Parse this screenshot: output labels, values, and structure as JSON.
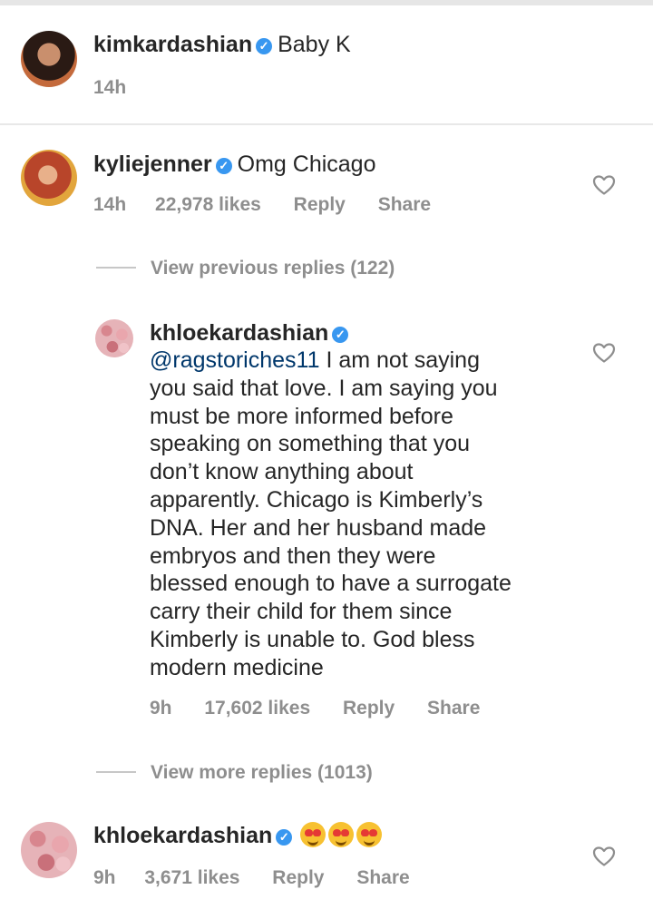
{
  "comments": [
    {
      "username": "kimkardashian",
      "text": "Baby K",
      "time": "14h"
    },
    {
      "username": "kyliejenner",
      "text": "Omg Chicago",
      "time": "14h",
      "likes": "22,978 likes",
      "reply": "Reply",
      "share": "Share"
    }
  ],
  "view_previous": "View previous replies (122)",
  "reply": {
    "username": "khloekardashian",
    "mention": "@ragstoriches11",
    "lines": [
      " I am not saying",
      "you said that love. I am saying you",
      "must be more informed before",
      "speaking on something that you",
      "don’t know anything about",
      "apparently. Chicago is Kimberly’s",
      "DNA. Her and her husband made",
      "embryos and then they were",
      "blessed enough to have a surrogate",
      "carry their child for them since",
      "Kimberly is unable to. God bless",
      "modern medicine"
    ],
    "time": "9h",
    "likes": "17,602 likes",
    "reply": "Reply",
    "share": "Share"
  },
  "view_more": "View more replies (1013)",
  "last_comment": {
    "username": "khloekardashian",
    "emojis": [
      "smiling-face-with-heart-eyes",
      "smiling-face-with-heart-eyes",
      "smiling-face-with-heart-eyes"
    ],
    "time": "9h",
    "likes": "3,671 likes",
    "reply": "Reply",
    "share": "Share"
  },
  "icons": {
    "like": "heart-outline-icon",
    "verified": "verified-badge-icon"
  },
  "colors": {
    "verified": "#3897f0",
    "meta": "#8e8e8e",
    "mention": "#00376b",
    "text": "#262626"
  }
}
